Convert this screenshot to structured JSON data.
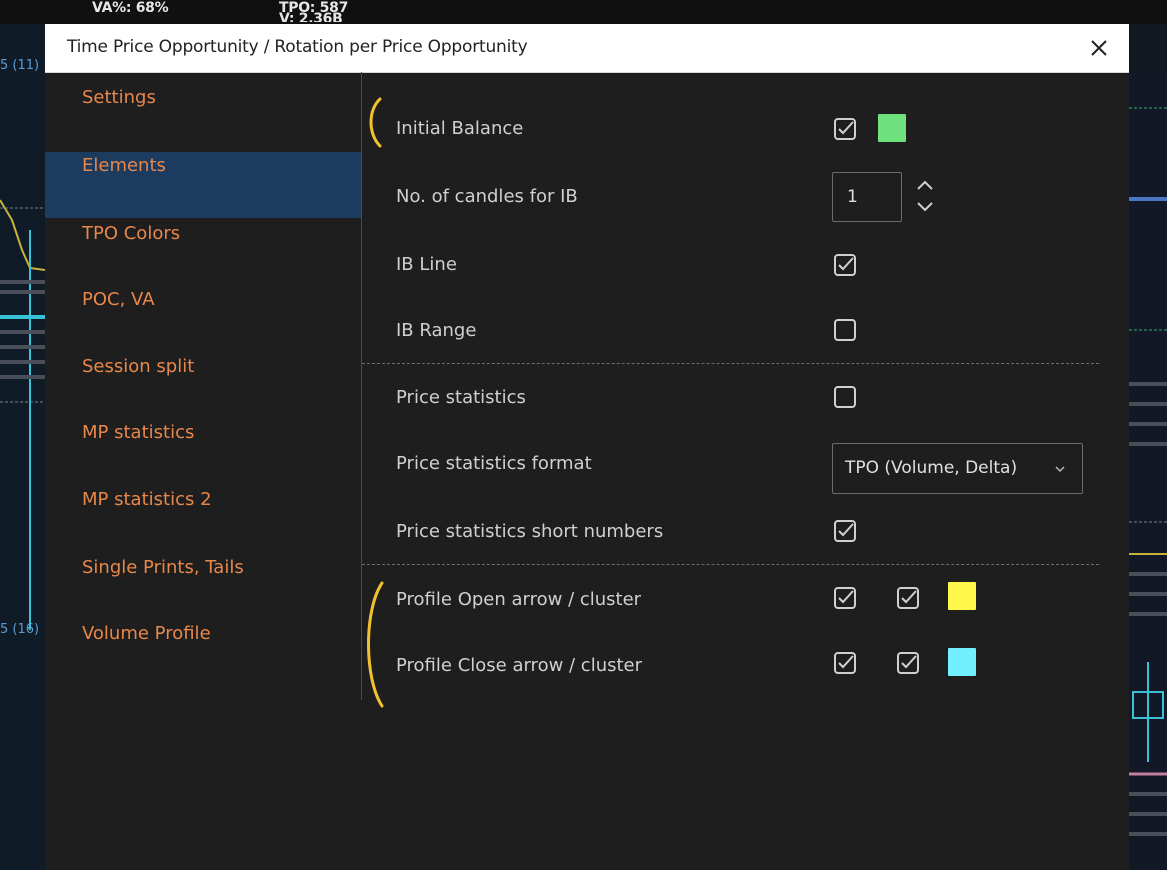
{
  "background": {
    "va_stat": "VA%: 68%",
    "tpo_stat": "TPO: 587",
    "tpo_stat_2": "V: 2.36B",
    "edge_label_1": "5 (11)",
    "edge_label_2": "5 (16)"
  },
  "dialog": {
    "title": "Time Price Opportunity / Rotation per Price Opportunity",
    "close_icon": "close-icon"
  },
  "sidebar": {
    "items": [
      {
        "label": "Settings",
        "active": false
      },
      {
        "label": "Elements",
        "active": true
      },
      {
        "label": "TPO Colors",
        "active": false
      },
      {
        "label": "POC, VA",
        "active": false
      },
      {
        "label": "Session split",
        "active": false
      },
      {
        "label": "MP statistics",
        "active": false
      },
      {
        "label": "MP statistics 2",
        "active": false
      },
      {
        "label": "Single Prints, Tails",
        "active": false
      },
      {
        "label": "Volume Profile",
        "active": false
      }
    ]
  },
  "elements": {
    "initial_balance": {
      "label": "Initial Balance",
      "checked": true,
      "color": "#6ee07e"
    },
    "ib_candles": {
      "label": "No. of candles for IB",
      "value": "1"
    },
    "ib_line": {
      "label": "IB Line",
      "checked": true
    },
    "ib_range": {
      "label": "IB Range",
      "checked": false
    },
    "price_statistics": {
      "label": "Price statistics",
      "checked": false
    },
    "price_statistics_format": {
      "label": "Price statistics format",
      "value": "TPO (Volume, Delta)"
    },
    "price_statistics_short": {
      "label": "Price statistics short numbers",
      "checked": true
    },
    "profile_open": {
      "label": "Profile Open arrow / cluster",
      "arrow_checked": true,
      "cluster_checked": true,
      "color": "#fff84a"
    },
    "profile_close": {
      "label": "Profile Close arrow / cluster",
      "arrow_checked": true,
      "cluster_checked": true,
      "color": "#72f0ff"
    }
  },
  "colors": {
    "accent_orange": "#e8874a",
    "active_bg": "#1d3a5f",
    "annotation_yellow": "#f2c12e"
  }
}
